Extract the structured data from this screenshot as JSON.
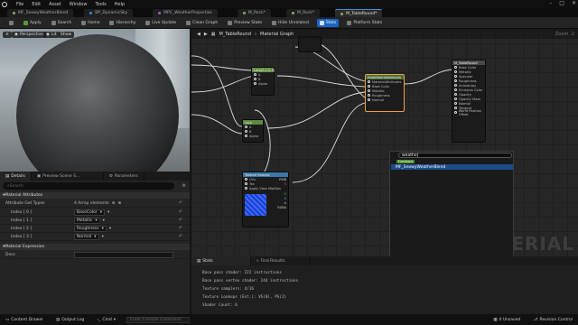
{
  "menu": [
    "File",
    "Edit",
    "Asset",
    "Window",
    "Tools",
    "Help"
  ],
  "tabs": [
    {
      "label": "MF_SnowyWeatherBlend",
      "color": "#7aa35a",
      "active": false
    },
    {
      "label": "BP_DynamicSky",
      "color": "#3d7fc4",
      "active": false
    },
    {
      "label": "MPC_WeatherProperties",
      "color": "#9a5ab0",
      "active": false
    },
    {
      "label": "M_Rock*",
      "color": "#7aa35a",
      "active": false
    },
    {
      "label": "M_Rock*",
      "color": "#7aa35a",
      "active": false
    },
    {
      "label": "M_TableRound*",
      "color": "#7aa35a",
      "active": true
    }
  ],
  "toolbar": {
    "save": "",
    "apply": "Apply",
    "search": "Search",
    "home": "Home",
    "hierarchy": "Hierarchy",
    "live_update": "Live Update",
    "clean_graph": "Clean Graph",
    "preview_state": "Preview State",
    "hide_unrelated": "Hide Unrelated",
    "stats": "Stats",
    "platform_stats": "Platform Stats"
  },
  "viewport": {
    "perspective": "Perspective",
    "lit": "Lit",
    "show": "Show"
  },
  "details": {
    "tabs": [
      "Details",
      "Preview Scene S...",
      "Parameters"
    ],
    "search_placeholder": "Search",
    "section_attrs": "Material Attributes",
    "attr_label": "Attribute Get Types",
    "attr_value": "4 Array elements",
    "rows": [
      {
        "label": "Index [ 0 ]",
        "value": "BaseColor"
      },
      {
        "label": "Index [ 1 ]",
        "value": "Metallic"
      },
      {
        "label": "Index [ 2 ]",
        "value": "Roughness"
      },
      {
        "label": "Index [ 3 ]",
        "value": "Normal"
      }
    ],
    "section_expr": "Material Expression",
    "desc_label": "Desc"
  },
  "graph": {
    "breadcrumb_root": "M_TableRound",
    "breadcrumb_leaf": "Material Graph",
    "zoom": "Zoom -2",
    "watermark": "MATERIAL",
    "nodes": {
      "lerp1": {
        "title": "Lerp(0,1,0.5)",
        "pins": [
          "A",
          "B",
          "Alpha"
        ]
      },
      "lerp2": {
        "title": "Lerp",
        "pins": [
          "A",
          "B",
          "Alpha"
        ]
      },
      "makeattr": {
        "title": "MakeMaterialAttributes",
        "pins": [
          "MaterialAttributes",
          "Base Color",
          "Metallic",
          "Roughness",
          "Normal"
        ]
      },
      "texsample": {
        "title": "Texture Sample",
        "pins": [
          "UVs",
          "Tex",
          "Apply View MipBias"
        ],
        "outs": [
          "RGB",
          "R",
          "G",
          "B",
          "A",
          "RGBA"
        ]
      },
      "result": {
        "title": "M_TableRound",
        "pins": [
          "Base Color",
          "Metallic",
          "Specular",
          "Roughness",
          "Anisotropy",
          "Emissive Color",
          "Opacity",
          "Opacity Mask",
          "Normal",
          "Tangent",
          "World Position Offset"
        ]
      }
    }
  },
  "search_popup": {
    "query": "weathe|",
    "category": "Functions",
    "result": "MF_SnowyWeatherBlend"
  },
  "bottom": {
    "tabs": [
      "Stats",
      "Find Results"
    ],
    "lines": [
      "Base pass shader: 222 instructions",
      "Base pass vertex shader: 244 instructions",
      "Texture samplers: 4/16",
      "Texture Lookups (Est.): VS(0), PS(2)",
      "Shader Count: 6"
    ]
  },
  "statusbar": {
    "content_drawer": "Content Drawer",
    "output_log": "Output Log",
    "cmd": "Cmd",
    "cmd_placeholder": "Enter Console Command",
    "unsaved": "4 Unsaved",
    "revision": "Revision Control"
  }
}
